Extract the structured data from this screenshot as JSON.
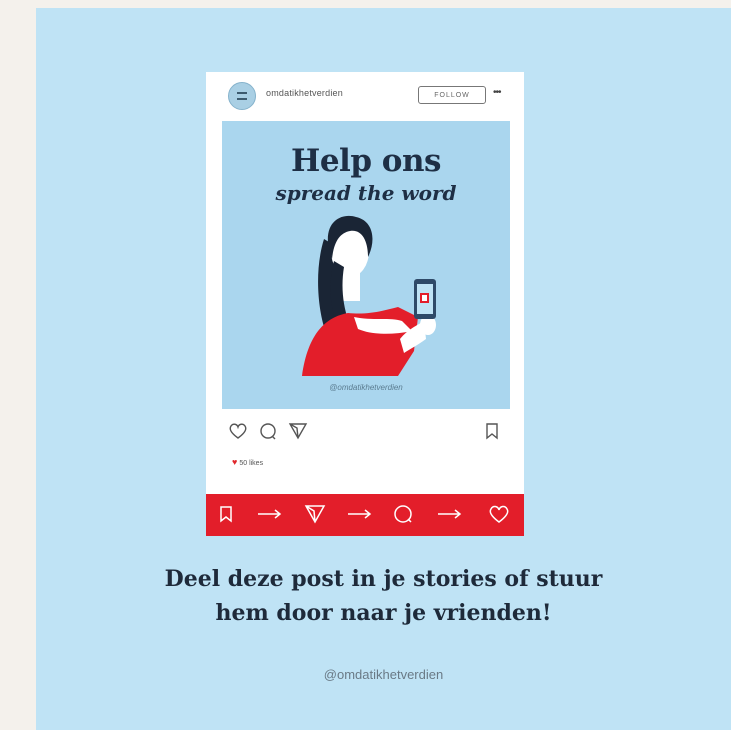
{
  "post": {
    "username": "omdatikhetverdien",
    "follow_label": "FOLLOW",
    "image": {
      "headline": "Help ons",
      "subline": "spread the word",
      "handle": "@omdatikhetverdien"
    },
    "likes_text": "50 likes"
  },
  "bar": {
    "steps": [
      "bookmark-icon",
      "arrow-icon",
      "send-icon",
      "arrow-icon",
      "comment-icon",
      "arrow-icon",
      "heart-icon"
    ]
  },
  "caption": {
    "line1": "Deel deze post in je stories of stuur",
    "line2": "hem door naar je vrienden!"
  },
  "footer": {
    "handle": "@omdatikhetverdien"
  },
  "colors": {
    "background": "#bfe3f5",
    "accent_red": "#e31e2a",
    "navy": "#1e2f45",
    "image_bg": "#aad6ee"
  }
}
